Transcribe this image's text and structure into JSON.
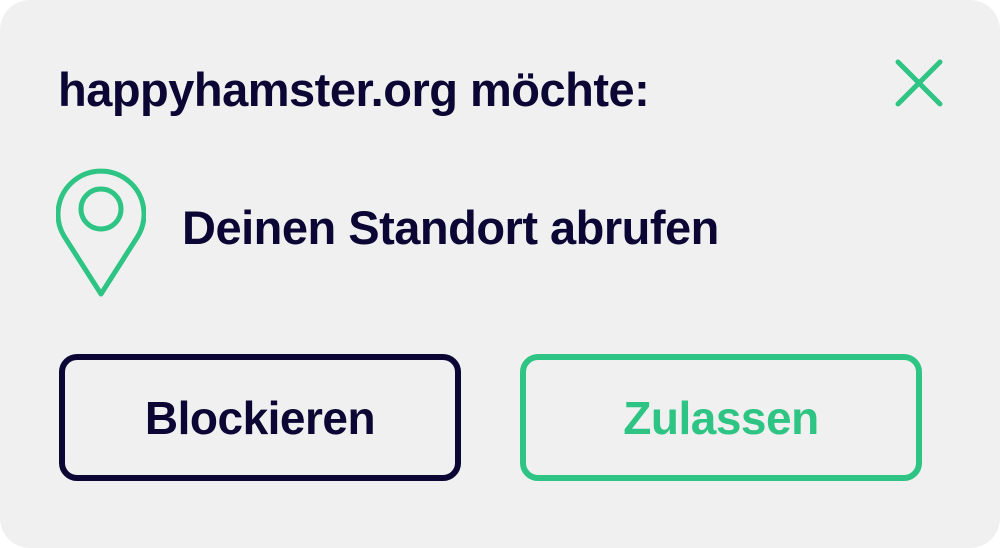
{
  "dialog": {
    "title": "happyhamster.org möchte:",
    "close_icon": "close-icon"
  },
  "permission": {
    "icon": "location-pin-icon",
    "text": "Deinen Standort abrufen"
  },
  "buttons": {
    "block_label": "Blockieren",
    "allow_label": "Zulassen"
  },
  "colors": {
    "background": "#f0f0f1",
    "text": "#0b0633",
    "accent": "#2ec483"
  }
}
